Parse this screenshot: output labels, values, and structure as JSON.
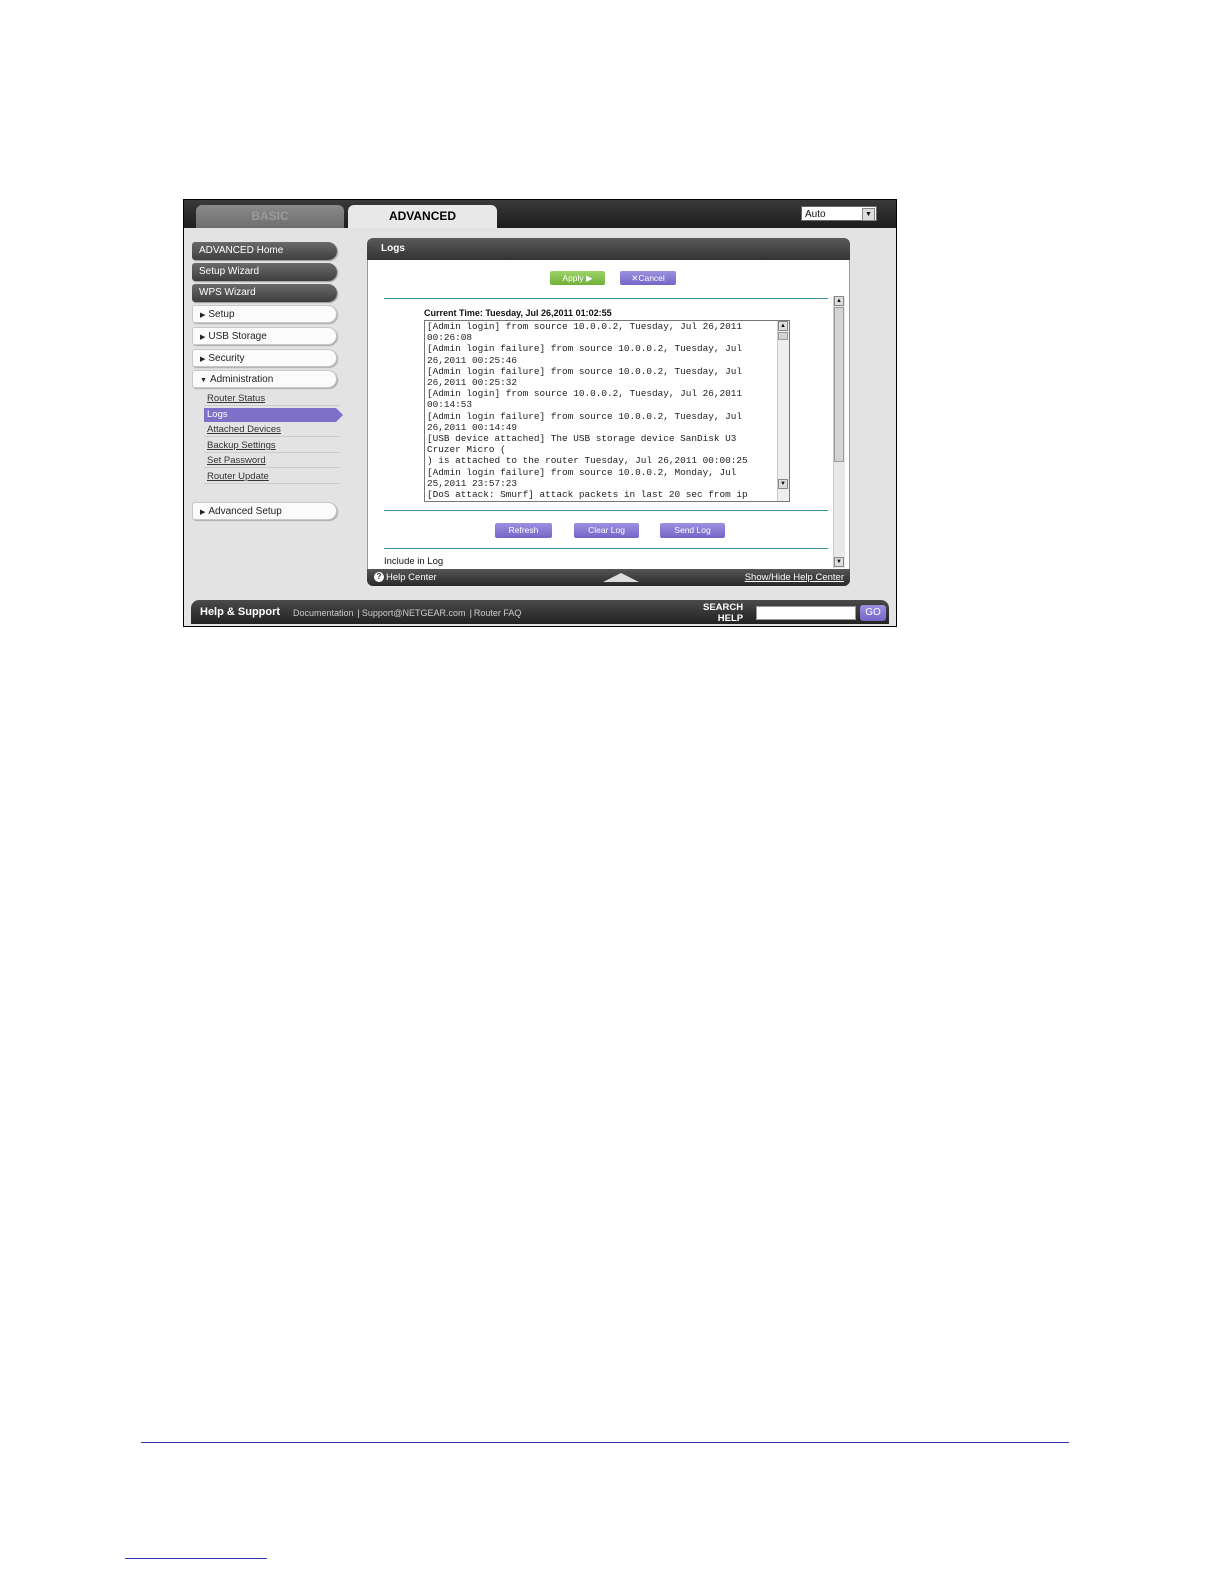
{
  "tabs": {
    "basic": "BASIC",
    "advanced": "ADVANCED"
  },
  "language": {
    "value": "Auto"
  },
  "sidebar": {
    "advanced_home": "ADVANCED Home",
    "setup_wizard": "Setup Wizard",
    "wps_wizard": "WPS Wizard",
    "setup": "Setup",
    "usb_storage": "USB Storage",
    "security": "Security",
    "administration": "Administration",
    "admin_items": [
      "Router Status",
      "Logs",
      "Attached Devices",
      "Backup Settings",
      "Set Password",
      "Router Update"
    ],
    "advanced_setup": "Advanced Setup"
  },
  "panel": {
    "title": "Logs",
    "apply": "Apply ▶",
    "cancel": "Cancel",
    "current_time": "Current Time: Tuesday, Jul 26,2011 01:02:55",
    "log_lines": [
      "[Admin login] from source 10.0.0.2, Tuesday, Jul 26,2011",
      "00:26:08",
      "[Admin login failure] from source 10.0.0.2, Tuesday, Jul",
      "26,2011 00:25:46",
      "[Admin login failure] from source 10.0.0.2, Tuesday, Jul",
      "26,2011 00:25:32",
      "[Admin login] from source 10.0.0.2, Tuesday, Jul 26,2011",
      "00:14:53",
      "[Admin login failure] from source 10.0.0.2, Tuesday, Jul",
      "26,2011 00:14:49",
      "[USB device attached] The USB storage device SanDisk U3",
      "Cruzer Micro (",
      ") is attached to the router Tuesday, Jul 26,2011 00:00:25",
      "[Admin login failure] from source 10.0.0.2, Monday, Jul",
      "25,2011 23:57:23",
      "[DoS attack: Smurf] attack packets in last 20 sec from ip"
    ],
    "refresh": "Refresh",
    "clear_log": "Clear Log",
    "send_log": "Send Log",
    "include_in_log": "Include in Log",
    "help_center": "Help Center",
    "show_hide_help": "Show/Hide Help Center"
  },
  "support": {
    "title": "Help & Support",
    "links": [
      "Documentation",
      "Support@NETGEAR.com",
      "Router FAQ"
    ],
    "search_label_1": "SEARCH",
    "search_label_2": "HELP",
    "go": "GO"
  },
  "colors": {
    "accent": "#7e70c9",
    "apply_green": "#7fbf45",
    "rule_teal": "#3a8fa5"
  }
}
